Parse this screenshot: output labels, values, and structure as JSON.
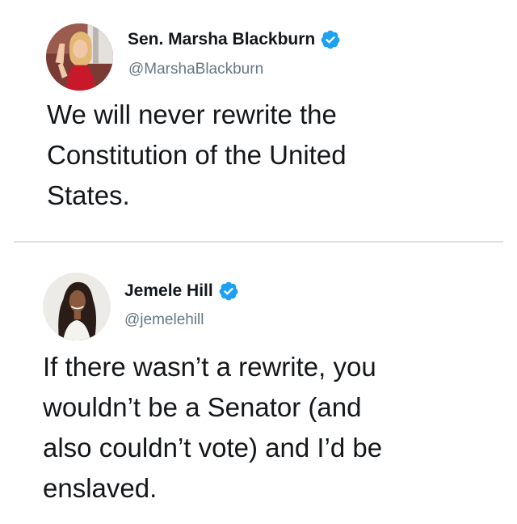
{
  "tweets": [
    {
      "display_name": "Sen. Marsha Blackburn",
      "handle": "@MarshaBlackburn",
      "verified": true,
      "avatar_icon": "profile-photo-woman-blonde",
      "text": "We will never rewrite the\nConstitution of the United\nStates."
    },
    {
      "display_name": "Jemele Hill",
      "handle": "@jemelehill",
      "verified": true,
      "avatar_icon": "profile-photo-woman-dark-hair",
      "text": "If there wasn’t a rewrite, you\nwouldn’t be a Senator (and\nalso couldn’t vote) and I’d be\nenslaved."
    }
  ],
  "colors": {
    "text": "#14171a",
    "handle": "#657786",
    "verified": "#1da1f2",
    "divider": "#dfe3e6"
  }
}
